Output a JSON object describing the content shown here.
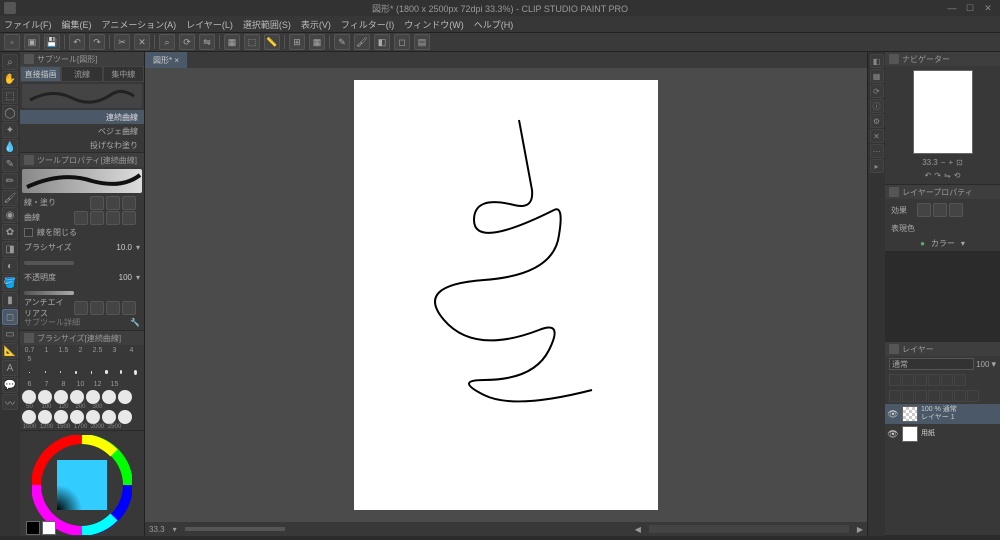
{
  "title": "図形* (1800 x 2500px 72dpi 33.3%) - CLIP STUDIO PAINT PRO",
  "menu": [
    "ファイル(F)",
    "編集(E)",
    "アニメーション(A)",
    "レイヤー(L)",
    "選択範囲(S)",
    "表示(V)",
    "フィルター(I)",
    "ウィンドウ(W)",
    "ヘルプ(H)"
  ],
  "doc_tab": "図形* ×",
  "subtool_title": "サブツール[図形]",
  "subtool_tabs": [
    "直接描画",
    "流線",
    "集中線"
  ],
  "subtool_items": [
    "連続曲線",
    "ベジェ曲線",
    "投げなわ塗り"
  ],
  "toolprop_title": "ツールプロパティ[連続曲線]",
  "prop_line_fill": "線・塗り",
  "prop_curve": "曲線",
  "prop_close": "線を閉じる",
  "prop_brushsize": "ブラシサイズ",
  "prop_brushsize_val": "10.0",
  "prop_opacity": "不透明度",
  "prop_opacity_val": "100",
  "prop_aa": "アンチエイリアス",
  "prop_more": "サブツール詳細",
  "brushsize_title": "ブラシサイズ[連続曲線]",
  "brush_sizes_1": [
    "0.7",
    "1",
    "1.5",
    "2",
    "2.5",
    "3",
    "4",
    "5"
  ],
  "brush_sizes_2": [
    "6",
    "7",
    "8",
    "10",
    "12",
    "15"
  ],
  "brush_sizes_3": [
    "50",
    "100",
    "120",
    "200",
    "300"
  ],
  "brush_sizes_4": [
    "1000",
    "1200",
    "1500",
    "1700",
    "2000",
    "2500"
  ],
  "navigator_title": "ナビゲーター",
  "zoom": "33.3",
  "layerprop_title": "レイヤープロパティ",
  "layerprop_effect": "効果",
  "layerprop_color": "表現色",
  "layerprop_color_val": "カラー",
  "layer_title": "レイヤー",
  "blend_mode": "通常",
  "blend_opacity": "100",
  "layers": [
    {
      "name": "100 % 通常",
      "sub": "レイヤー 1",
      "active": true,
      "checker": true
    },
    {
      "name": "用紙",
      "sub": "",
      "active": false,
      "checker": false
    }
  ],
  "status_zoom": "33.3"
}
